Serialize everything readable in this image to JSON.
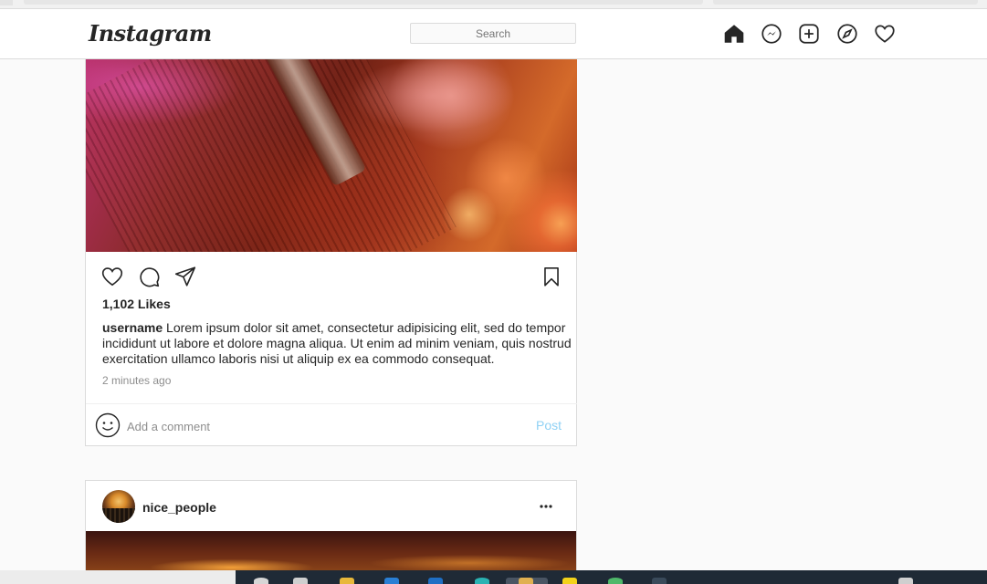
{
  "nav": {
    "logo": "Instagram",
    "search_placeholder": "Search",
    "icons": [
      "home-icon",
      "messenger-icon",
      "new-post-icon",
      "explore-icon",
      "activity-heart-icon"
    ]
  },
  "post1": {
    "likes": "1,102 Likes",
    "username": "username",
    "caption": "Lorem ipsum dolor sit amet, consectetur adipisicing elit, sed do tempor incididunt ut labore et dolore magna aliqua. Ut enim ad minim veniam, quis nostrud exercitation ullamco laboris nisi ut aliquip ex ea commodo consequat.",
    "timestamp": "2 minutes ago",
    "comment_placeholder": "Add a comment",
    "post_label": "Post"
  },
  "post2": {
    "username": "nice_people"
  },
  "colors": {
    "post_button": "#8fd1f5",
    "text": "#262626",
    "muted": "#8e8e8e",
    "border": "#dbdbdb"
  }
}
